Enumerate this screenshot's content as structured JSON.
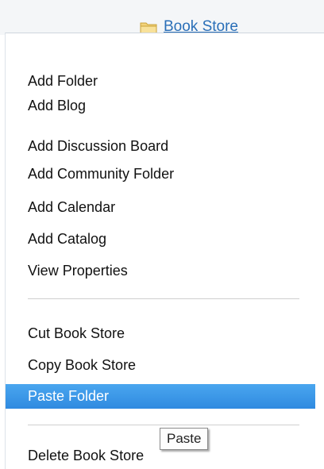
{
  "tree": {
    "node_label": "Book Store",
    "icon": "folder-icon"
  },
  "menu": {
    "items": [
      {
        "label": "Add Folder"
      },
      {
        "label": "Add Blog"
      },
      {
        "label": "Add Discussion Board"
      },
      {
        "label": "Add Community Folder"
      },
      {
        "label": "Add Calendar"
      },
      {
        "label": "Add Catalog"
      },
      {
        "label": "View Properties"
      },
      {
        "label": "Cut Book Store"
      },
      {
        "label": "Copy Book Store"
      },
      {
        "label": "Paste Folder",
        "highlighted": true
      },
      {
        "label": "Delete Book Store"
      }
    ]
  },
  "tooltip": {
    "text": "Paste"
  },
  "colors": {
    "highlight": "#2f8ae0",
    "link": "#2a6fb8"
  }
}
